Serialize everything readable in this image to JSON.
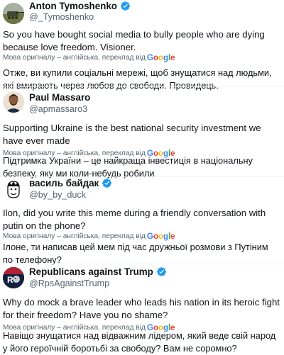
{
  "translation_note": {
    "label": "Мова оригіналу – англійська, переклад від",
    "brand": "Google"
  },
  "tweets": [
    {
      "name": "Anton Tymoshenko",
      "verified": true,
      "handle": "@_Tymoshenko",
      "text": "So you have bought social media to bully people who are dying because love freedom.  Visioner.",
      "translation": "Отже, ви купили соціальні мережі, щоб знущатися над людьми, які вмирають через любов до свободи. Провидець.",
      "avatar_icon": "tank-photo-avatar"
    },
    {
      "name": "Paul Massaro",
      "verified": false,
      "handle": "@apmassaro3",
      "text": "Supporting Ukraine is the best national security investment we have ever made",
      "translation": "Підтримка України – це найкраща інвестиція в національну безпеку, яку ми коли-небудь робили",
      "avatar_icon": "person-photo-avatar"
    },
    {
      "name": "василь байдак",
      "verified": true,
      "handle": "@by_by_duck",
      "text": "Ilon, did you write this meme during a friendly conversation with putin on the phone?",
      "translation": "Ілоне, ти написав цей мем під час дружньої розмови з Путіним по телефону?",
      "avatar_icon": "cartoon-face-avatar"
    },
    {
      "name": "Republicans against Trump",
      "verified": true,
      "handle": "@RpsAgainstTrump",
      "text": "Why do mock a brave leader who leads his nation in its heroic fight for their freedom? Have you no shame?",
      "translation": "Навіщо знущатися над відважним лідером, який веде свій народ у його героїчній боротьбі за свободу? Вам не соромно?",
      "avatar_icon": "rat-logo-avatar"
    }
  ]
}
